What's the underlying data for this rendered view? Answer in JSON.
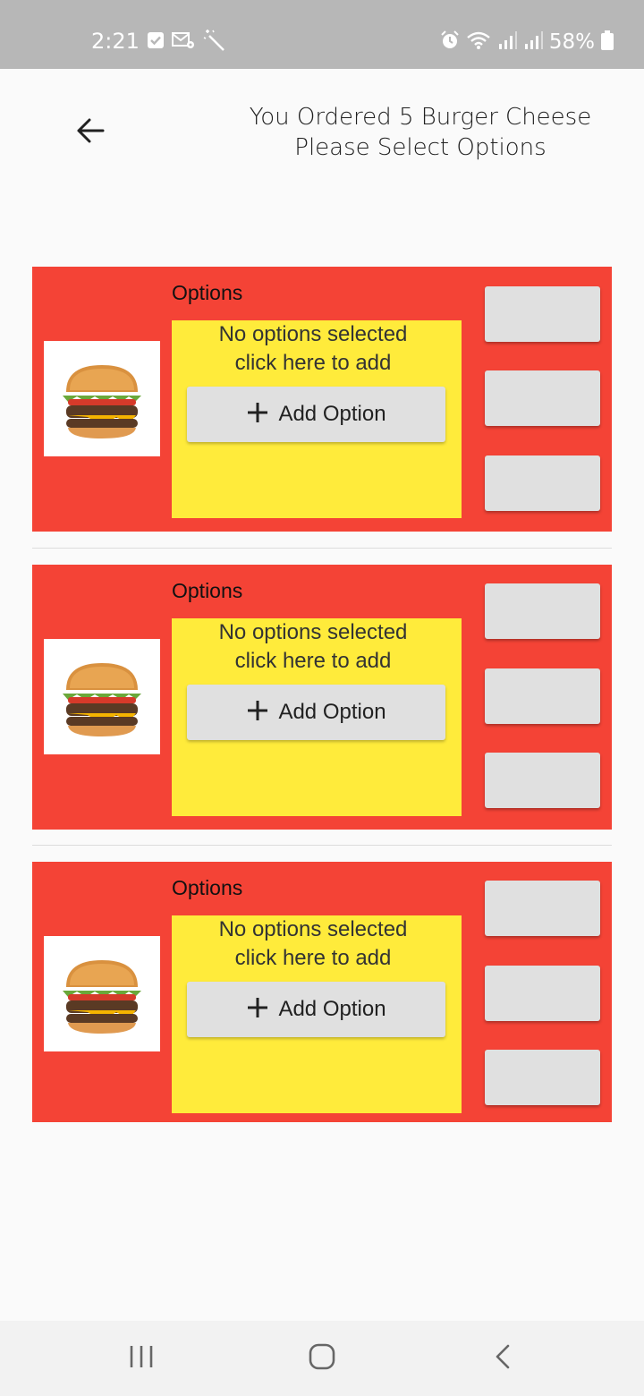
{
  "status_bar": {
    "time": "2:21",
    "battery": "58%",
    "icons_left": [
      "checkbox-notification-icon",
      "mail-settings-icon",
      "magic-wand-icon"
    ],
    "icons_right": [
      "alarm-icon",
      "wifi-icon",
      "signal-icon",
      "signal-icon",
      "battery-icon"
    ]
  },
  "header": {
    "title_line1": "You Ordered 5 Burger Cheese",
    "title_line2": "Please Select Options",
    "back_icon": "arrow-left-icon"
  },
  "items": [
    {
      "options_label": "Options",
      "empty_line1": "No options selected",
      "empty_line2": "click here to add",
      "add_option_label": "Add Option"
    },
    {
      "options_label": "Options",
      "empty_line1": "No options selected",
      "empty_line2": "click here to add",
      "add_option_label": "Add Option"
    },
    {
      "options_label": "Options",
      "empty_line1": "No options selected",
      "empty_line2": "click here to add",
      "add_option_label": "Add Option"
    }
  ],
  "colors": {
    "card_background": "#f44336",
    "options_box": "#ffeb3b",
    "button_grey": "#e0e0e0",
    "status_bar": "#b7b7b7"
  },
  "nav_bar": {
    "icons": [
      "recent-apps-icon",
      "home-icon",
      "back-icon"
    ]
  }
}
